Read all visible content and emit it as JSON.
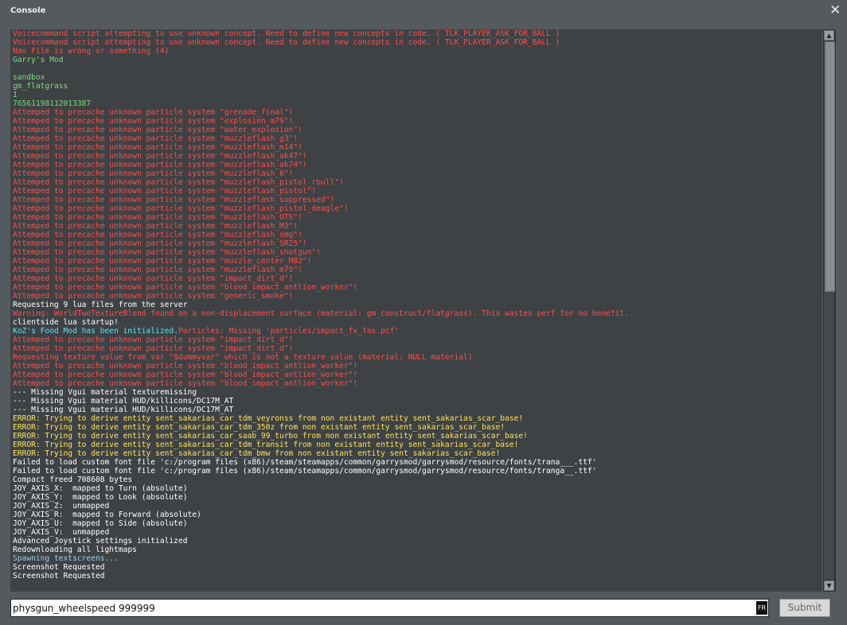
{
  "window": {
    "title": "Console",
    "close_glyph": "✕",
    "close_icon": "close-icon"
  },
  "colors": {
    "red": "#ff4c4c",
    "yellow": "#ffe25a",
    "green": "#7fd87f",
    "white": "#ffffff",
    "cyan": "#5fe3f2",
    "lightblue": "#9ccfe6"
  },
  "console": {
    "lines": [
      {
        "text": "Voicecommand script attempting to use unknown concept. Need to define new concepts in code. ( TLK_PLAYER_ASK_FOR_BALL )",
        "color": "red"
      },
      {
        "text": "Voicecommand script attempting to use unknown concept. Need to define new concepts in code. ( TLK_PLAYER_ASK_FOR_BALL )",
        "color": "red"
      },
      {
        "text": "Nav File is wrong or something (4)",
        "color": "red"
      },
      {
        "text": "Garry's Mod",
        "color": "green"
      },
      {
        "text": "",
        "color": "green"
      },
      {
        "text": "sandbox",
        "color": "green"
      },
      {
        "text": "gm_flatgrass",
        "color": "green"
      },
      {
        "text": "1",
        "color": "green"
      },
      {
        "text": "76561198112013387",
        "color": "green"
      },
      {
        "text": "Attemped to precache unknown particle system \"grenade_final\"!",
        "color": "red"
      },
      {
        "text": "Attemped to precache unknown particle system \"explosion_m79\"!",
        "color": "red"
      },
      {
        "text": "Attemped to precache unknown particle system \"water_explosion\"!",
        "color": "red"
      },
      {
        "text": "Attemped to precache unknown particle system \"muzzleflash_g3\"!",
        "color": "red"
      },
      {
        "text": "Attemped to precache unknown particle system \"muzzleflash_m14\"!",
        "color": "red"
      },
      {
        "text": "Attemped to precache unknown particle system \"muzzleflash_ak47\"!",
        "color": "red"
      },
      {
        "text": "Attemped to precache unknown particle system \"muzzleflash_ak74\"!",
        "color": "red"
      },
      {
        "text": "Attemped to precache unknown particle system \"muzzleflash_6\"!",
        "color": "red"
      },
      {
        "text": "Attemped to precache unknown particle system \"muzzleflash_pistol_rbull\"!",
        "color": "red"
      },
      {
        "text": "Attemped to precache unknown particle system \"muzzleflash_pistol\"!",
        "color": "red"
      },
      {
        "text": "Attemped to precache unknown particle system \"muzzleflash_suppressed\"!",
        "color": "red"
      },
      {
        "text": "Attemped to precache unknown particle system \"muzzleflash_pistol_deagle\"!",
        "color": "red"
      },
      {
        "text": "Attemped to precache unknown particle system \"muzzleflash_OTS\"!",
        "color": "red"
      },
      {
        "text": "Attemped to precache unknown particle system \"muzzleflash_M3\"!",
        "color": "red"
      },
      {
        "text": "Attemped to precache unknown particle system \"muzzleflash_smg\"!",
        "color": "red"
      },
      {
        "text": "Attemped to precache unknown particle system \"muzzleflash_SR25\"!",
        "color": "red"
      },
      {
        "text": "Attemped to precache unknown particle system \"muzzleflash_shotgun\"!",
        "color": "red"
      },
      {
        "text": "Attemped to precache unknown particle system \"muzzle_center_M82\"!",
        "color": "red"
      },
      {
        "text": "Attemped to precache unknown particle system \"muzzleflash_m79\"!",
        "color": "red"
      },
      {
        "text": "Attemped to precache unknown particle system \"impact_dirt_d\"!",
        "color": "red"
      },
      {
        "text": "Attemped to precache unknown particle system \"blood_impact_antlion_worker\"!",
        "color": "red"
      },
      {
        "text": "Attemped to precache unknown particle system \"generic_smoke\"!",
        "color": "red"
      },
      {
        "text": "Requesting 9 lua files from the server",
        "color": "white"
      },
      {
        "text": "Warning: WorldTwoTextureBlend found on a non-displacement surface (material: gm_construct/flatgrass). This wastes perf for no benefit.",
        "color": "red"
      },
      {
        "text": "clientside lua startup!",
        "color": "white"
      },
      {
        "segments": [
          {
            "text": "KoZ's Food Mod has been initialized.",
            "color": "cyan"
          },
          {
            "text": "Particles: Missing 'particles/impact_fx_fas.pcf'",
            "color": "red"
          }
        ]
      },
      {
        "text": "Attemped to precache unknown particle system \"impact_dirt_d\"!",
        "color": "red"
      },
      {
        "text": "Attemped to precache unknown particle system \"impact_dirt_d\"!",
        "color": "red"
      },
      {
        "text": "Requesting texture value from var \"$dummyvar\" which is not a texture value (material: NULL material)",
        "color": "red"
      },
      {
        "text": "Attemped to precache unknown particle system \"blood_impact_antlion_worker\"!",
        "color": "red"
      },
      {
        "text": "Attemped to precache unknown particle system \"blood_impact_antlion_worker\"!",
        "color": "red"
      },
      {
        "text": "Attemped to precache unknown particle system \"blood_impact_antlion_worker\"!",
        "color": "red"
      },
      {
        "text": "--- Missing Vgui material texturemissing",
        "color": "white"
      },
      {
        "text": "--- Missing Vgui material HUD/killicons/DC17M_AT",
        "color": "white"
      },
      {
        "text": "--- Missing Vgui material HUD/killicons/DC17M_AT",
        "color": "white"
      },
      {
        "text": "ERROR: Trying to derive entity sent_sakarias_car_tdm_veyronss from non existant entity sent_sakarias_scar_base!",
        "color": "yellow"
      },
      {
        "text": "ERROR: Trying to derive entity sent_sakarias_car_tdm_350z from non existant entity sent_sakarias_scar_base!",
        "color": "yellow"
      },
      {
        "text": "ERROR: Trying to derive entity sent_sakarias_car_saab_99_turbo from non existant entity sent_sakarias_scar_base!",
        "color": "yellow"
      },
      {
        "text": "ERROR: Trying to derive entity sent_sakarias_car_tdm_transit from non existant entity sent_sakarias_scar_base!",
        "color": "yellow"
      },
      {
        "text": "ERROR: Trying to derive entity sent_sakarias_car_tdm_bmw from non existant entity sent_sakarias_scar_base!",
        "color": "yellow"
      },
      {
        "text": "Failed to load custom font file 'c:/program files (x86)/steam/steamapps/common/garrysmod/garrysmod/resource/fonts/trana___.ttf'",
        "color": "white"
      },
      {
        "text": "Failed to load custom font file 'c:/program files (x86)/steam/steamapps/common/garrysmod/garrysmod/resource/fonts/tranga__.ttf'",
        "color": "white"
      },
      {
        "text": "Compact freed 708608 bytes",
        "color": "white"
      },
      {
        "text": "JOY_AXIS_X:  mapped to Turn (absolute)",
        "color": "white"
      },
      {
        "text": "JOY_AXIS_Y:  mapped to Look (absolute)",
        "color": "white"
      },
      {
        "text": "JOY_AXIS_Z:  unmapped",
        "color": "white"
      },
      {
        "text": "JOY_AXIS_R:  mapped to Forward (absolute)",
        "color": "white"
      },
      {
        "text": "JOY_AXIS_U:  mapped to Side (absolute)",
        "color": "white"
      },
      {
        "text": "JOY_AXIS_V:  unmapped",
        "color": "white"
      },
      {
        "text": "Advanced Joystick settings initialized",
        "color": "white"
      },
      {
        "text": "Redownloading all lightmaps",
        "color": "white"
      },
      {
        "text": "Spawning textscreens...",
        "color": "lightblue"
      },
      {
        "text": "Screenshot Requested",
        "color": "white"
      },
      {
        "text": "Screenshot Requested",
        "color": "white"
      }
    ]
  },
  "scrollbar": {
    "up_glyph": "▲",
    "down_glyph": "▼",
    "thumb_start_fraction": 0.0,
    "thumb_size_fraction": 0.465
  },
  "input": {
    "value": "physgun_wheelspeed 999999",
    "ime_badge": "FR"
  },
  "submit": {
    "label": "Submit"
  }
}
